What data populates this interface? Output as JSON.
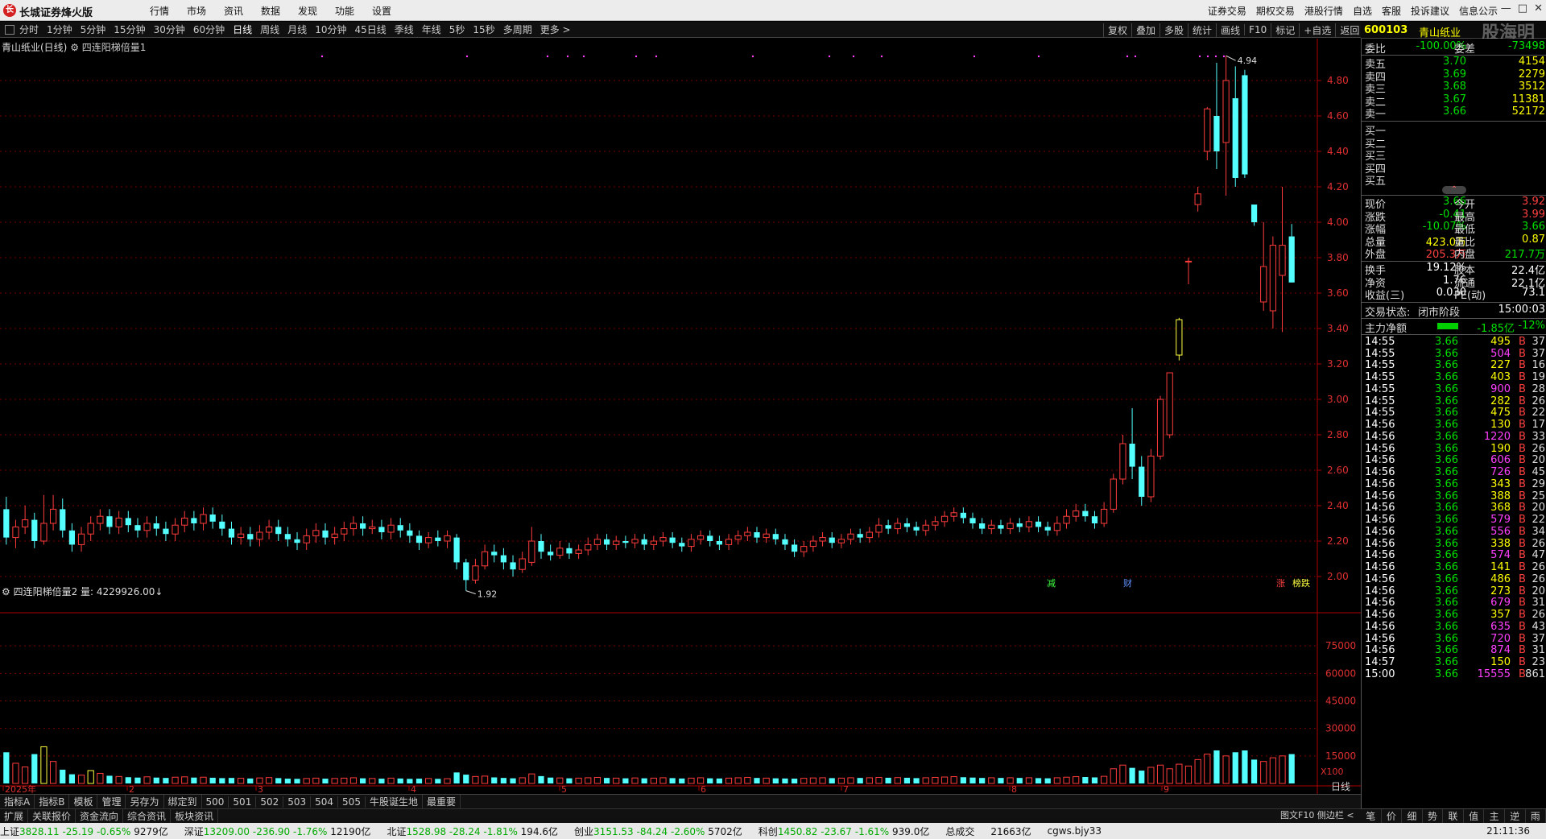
{
  "app": {
    "title": "长城证券烽火版",
    "menus": [
      "行情",
      "市场",
      "资讯",
      "数据",
      "发现",
      "功能",
      "设置"
    ],
    "right_menus": [
      "证券交易",
      "期权交易",
      "港股行情",
      "自选",
      "客服",
      "投诉建议",
      "信息公示"
    ]
  },
  "period_bar": {
    "items": [
      "分时",
      "1分钟",
      "5分钟",
      "15分钟",
      "30分钟",
      "60分钟",
      "日线",
      "周线",
      "月线",
      "10分钟",
      "45日线",
      "季线",
      "年线",
      "5秒",
      "15秒",
      "多周期",
      "更多 >"
    ],
    "active": "日线",
    "right_tools": [
      "复权",
      "叠加",
      "多股",
      "统计",
      "画线",
      "F10",
      "标记",
      "+自选",
      "返回"
    ]
  },
  "main_chart": {
    "title": "青山纸业(日线)",
    "indicator": "四连阳梯倍量1",
    "y_ticks": [
      "4.80",
      "4.60",
      "4.40",
      "4.20",
      "4.00",
      "3.80",
      "3.60",
      "3.40",
      "3.20",
      "3.00",
      "2.80",
      "2.60",
      "2.40",
      "2.20",
      "2.00"
    ],
    "high_label": "4.94",
    "low_label": "1.92",
    "markers": [
      "减",
      "财",
      "涨",
      "榜跌"
    ]
  },
  "volume_chart": {
    "title": "四连阳梯倍量2 量: 4229926.00",
    "y_ticks": [
      "75000",
      "60000",
      "45000",
      "30000",
      "15000"
    ],
    "unit": "X100"
  },
  "x_axis": [
    "2025年",
    "2",
    "3",
    "4",
    "5",
    "6",
    "7",
    "8",
    "9"
  ],
  "day_line": "日线",
  "tabs1": [
    "指标A",
    "指标B",
    "模板",
    "管理",
    "另存为",
    "绑定到",
    "500",
    "501",
    "502",
    "503",
    "504",
    "505",
    "牛股诞生地",
    "最重要"
  ],
  "tabs2": [
    "扩展",
    "关联报价",
    "资金流向",
    "综合资讯",
    "板块资讯"
  ],
  "small_btns": "图文F10  侧边栏 <",
  "right_tabs": [
    "笔",
    "价",
    "细",
    "势",
    "联",
    "值",
    "主",
    "逆",
    "雨"
  ],
  "stock": {
    "code": "600103",
    "name": "青山纸业",
    "watermark": "股海明灯",
    "webi": "委比",
    "webi_val": "-100.00%",
    "weicha": "委差",
    "weicha_val": "-73498",
    "sell": [
      {
        "label": "卖五",
        "price": "3.70",
        "vol": "4154"
      },
      {
        "label": "卖四",
        "price": "3.69",
        "vol": "2279"
      },
      {
        "label": "卖三",
        "price": "3.68",
        "vol": "3512"
      },
      {
        "label": "卖二",
        "price": "3.67",
        "vol": "11381"
      },
      {
        "label": "卖一",
        "price": "3.66",
        "vol": "52172"
      }
    ],
    "buy": [
      {
        "label": "买一"
      },
      {
        "label": "买二"
      },
      {
        "label": "买三"
      },
      {
        "label": "买四"
      },
      {
        "label": "买五"
      }
    ],
    "quote": [
      {
        "l1": "现价",
        "v1": "3.66",
        "c1": "green",
        "l2": "今开",
        "v2": "3.92",
        "c2": "red"
      },
      {
        "l1": "涨跌",
        "v1": "-0.41",
        "c1": "green",
        "l2": "最高",
        "v2": "3.99",
        "c2": "red"
      },
      {
        "l1": "涨幅",
        "v1": "-10.07%",
        "c1": "green",
        "l2": "最低",
        "v2": "3.66",
        "c2": "green"
      },
      {
        "l1": "总量",
        "v1": "423.0万",
        "c1": "yellow",
        "l2": "量比",
        "v2": "0.87",
        "c2": "yellow"
      },
      {
        "l1": "外盘",
        "v1": "205.3万",
        "c1": "red",
        "l2": "内盘",
        "v2": "217.7万",
        "c2": "green"
      }
    ],
    "quote2": [
      {
        "l1": "换手",
        "v1": "19.12%",
        "l2": "股本",
        "v2": "22.4亿"
      },
      {
        "l1": "净资",
        "v1": "1.76",
        "l2": "流通",
        "v2": "22.1亿"
      },
      {
        "l1": "收益(三)",
        "v1": "0.030",
        "l2": "PE(动)",
        "v2": "73.1"
      }
    ],
    "trade_status_label": "交易状态:",
    "trade_status": "闭市阶段",
    "trade_time": "15:00:03",
    "main_net_label": "主力净额",
    "main_net_val": "-1.85亿",
    "main_net_pct": "-12%"
  },
  "ticks": [
    {
      "t": "14:55",
      "p": "3.66",
      "v": "495",
      "m": false,
      "c": "37"
    },
    {
      "t": "14:55",
      "p": "3.66",
      "v": "504",
      "m": true,
      "c": "37"
    },
    {
      "t": "14:55",
      "p": "3.66",
      "v": "227",
      "m": false,
      "c": "16"
    },
    {
      "t": "14:55",
      "p": "3.66",
      "v": "403",
      "m": false,
      "c": "19"
    },
    {
      "t": "14:55",
      "p": "3.66",
      "v": "900",
      "m": true,
      "c": "28"
    },
    {
      "t": "14:55",
      "p": "3.66",
      "v": "282",
      "m": false,
      "c": "26"
    },
    {
      "t": "14:55",
      "p": "3.66",
      "v": "475",
      "m": false,
      "c": "22"
    },
    {
      "t": "14:56",
      "p": "3.66",
      "v": "130",
      "m": false,
      "c": "17"
    },
    {
      "t": "14:56",
      "p": "3.66",
      "v": "1220",
      "m": true,
      "c": "33"
    },
    {
      "t": "14:56",
      "p": "3.66",
      "v": "190",
      "m": false,
      "c": "26"
    },
    {
      "t": "14:56",
      "p": "3.66",
      "v": "606",
      "m": true,
      "c": "20"
    },
    {
      "t": "14:56",
      "p": "3.66",
      "v": "726",
      "m": true,
      "c": "45"
    },
    {
      "t": "14:56",
      "p": "3.66",
      "v": "343",
      "m": false,
      "c": "29"
    },
    {
      "t": "14:56",
      "p": "3.66",
      "v": "388",
      "m": false,
      "c": "25"
    },
    {
      "t": "14:56",
      "p": "3.66",
      "v": "368",
      "m": false,
      "c": "20"
    },
    {
      "t": "14:56",
      "p": "3.66",
      "v": "579",
      "m": true,
      "c": "22"
    },
    {
      "t": "14:56",
      "p": "3.66",
      "v": "556",
      "m": true,
      "c": "34"
    },
    {
      "t": "14:56",
      "p": "3.66",
      "v": "338",
      "m": false,
      "c": "26"
    },
    {
      "t": "14:56",
      "p": "3.66",
      "v": "574",
      "m": true,
      "c": "47"
    },
    {
      "t": "14:56",
      "p": "3.66",
      "v": "141",
      "m": false,
      "c": "26"
    },
    {
      "t": "14:56",
      "p": "3.66",
      "v": "486",
      "m": false,
      "c": "26"
    },
    {
      "t": "14:56",
      "p": "3.66",
      "v": "273",
      "m": false,
      "c": "20"
    },
    {
      "t": "14:56",
      "p": "3.66",
      "v": "679",
      "m": true,
      "c": "31"
    },
    {
      "t": "14:56",
      "p": "3.66",
      "v": "357",
      "m": false,
      "c": "26"
    },
    {
      "t": "14:56",
      "p": "3.66",
      "v": "635",
      "m": true,
      "c": "43"
    },
    {
      "t": "14:56",
      "p": "3.66",
      "v": "720",
      "m": true,
      "c": "37"
    },
    {
      "t": "14:56",
      "p": "3.66",
      "v": "874",
      "m": true,
      "c": "31"
    },
    {
      "t": "14:57",
      "p": "3.66",
      "v": "150",
      "m": false,
      "c": "23"
    },
    {
      "t": "15:00",
      "p": "3.66",
      "v": "15555",
      "m": true,
      "c": "861"
    }
  ],
  "statusbar": [
    {
      "name": "上证",
      "val": "3828.11",
      "chg": "-25.19",
      "pct": "-0.65%",
      "amt": "9279亿"
    },
    {
      "name": "深证",
      "val": "13209.00",
      "chg": "-236.90",
      "pct": "-1.76%",
      "amt": "12190亿"
    },
    {
      "name": "北证",
      "val": "1528.98",
      "chg": "-28.24",
      "pct": "-1.81%",
      "amt": "194.6亿"
    },
    {
      "name": "创业",
      "val": "3151.53",
      "chg": "-84.24",
      "pct": "-2.60%",
      "amt": "5702亿"
    },
    {
      "name": "科创",
      "val": "1450.82",
      "chg": "-23.67",
      "pct": "-1.61%",
      "amt": "939.0亿"
    }
  ],
  "status_total_label": "总成交",
  "status_total": "21663亿",
  "status_server": "cgws.bjy33",
  "status_time": "21:11:36",
  "chart_data": {
    "type": "candlestick",
    "title": "青山纸业(日线)",
    "y_range": [
      1.9,
      5.0
    ],
    "volume_range": [
      0,
      90000
    ],
    "candles": [
      [
        2.38,
        2.22,
        2.45,
        2.18
      ],
      [
        2.22,
        2.28,
        2.32,
        2.16
      ],
      [
        2.28,
        2.32,
        2.4,
        2.24
      ],
      [
        2.32,
        2.2,
        2.36,
        2.16
      ],
      [
        2.2,
        2.3,
        2.46,
        2.18
      ],
      [
        2.3,
        2.38,
        2.46,
        2.26
      ],
      [
        2.38,
        2.26,
        2.44,
        2.22
      ],
      [
        2.26,
        2.18,
        2.3,
        2.14
      ],
      [
        2.18,
        2.24,
        2.28,
        2.14
      ],
      [
        2.24,
        2.3,
        2.34,
        2.2
      ],
      [
        2.3,
        2.34,
        2.38,
        2.26
      ],
      [
        2.34,
        2.28,
        2.38,
        2.24
      ],
      [
        2.28,
        2.33,
        2.37,
        2.24
      ],
      [
        2.33,
        2.29,
        2.37,
        2.25
      ],
      [
        2.29,
        2.26,
        2.33,
        2.22
      ],
      [
        2.26,
        2.3,
        2.34,
        2.22
      ],
      [
        2.3,
        2.27,
        2.34,
        2.23
      ],
      [
        2.27,
        2.24,
        2.31,
        2.2
      ],
      [
        2.24,
        2.29,
        2.33,
        2.2
      ],
      [
        2.29,
        2.33,
        2.37,
        2.25
      ],
      [
        2.33,
        2.3,
        2.37,
        2.26
      ],
      [
        2.3,
        2.35,
        2.39,
        2.26
      ],
      [
        2.35,
        2.31,
        2.39,
        2.27
      ],
      [
        2.31,
        2.27,
        2.35,
        2.23
      ],
      [
        2.27,
        2.22,
        2.31,
        2.18
      ],
      [
        2.22,
        2.24,
        2.28,
        2.18
      ],
      [
        2.24,
        2.21,
        2.28,
        2.17
      ],
      [
        2.21,
        2.25,
        2.29,
        2.17
      ],
      [
        2.25,
        2.28,
        2.32,
        2.21
      ],
      [
        2.28,
        2.24,
        2.32,
        2.2
      ],
      [
        2.24,
        2.21,
        2.28,
        2.17
      ],
      [
        2.21,
        2.19,
        2.25,
        2.15
      ],
      [
        2.19,
        2.23,
        2.27,
        2.15
      ],
      [
        2.23,
        2.26,
        2.3,
        2.19
      ],
      [
        2.26,
        2.22,
        2.3,
        2.18
      ],
      [
        2.22,
        2.24,
        2.28,
        2.18
      ],
      [
        2.24,
        2.27,
        2.31,
        2.2
      ],
      [
        2.27,
        2.3,
        2.34,
        2.23
      ],
      [
        2.3,
        2.27,
        2.34,
        2.23
      ],
      [
        2.27,
        2.28,
        2.32,
        2.24
      ],
      [
        2.28,
        2.25,
        2.32,
        2.21
      ],
      [
        2.25,
        2.29,
        2.33,
        2.21
      ],
      [
        2.29,
        2.26,
        2.33,
        2.22
      ],
      [
        2.26,
        2.23,
        2.3,
        2.19
      ],
      [
        2.23,
        2.19,
        2.26,
        2.15
      ],
      [
        2.19,
        2.22,
        2.25,
        2.16
      ],
      [
        2.22,
        2.2,
        2.26,
        2.17
      ],
      [
        2.2,
        2.23,
        2.26,
        2.16
      ],
      [
        2.22,
        2.08,
        2.24,
        2.04
      ],
      [
        2.08,
        1.98,
        2.1,
        1.92
      ],
      [
        1.98,
        2.06,
        2.1,
        1.96
      ],
      [
        2.06,
        2.14,
        2.18,
        2.04
      ],
      [
        2.14,
        2.12,
        2.18,
        2.08
      ],
      [
        2.12,
        2.08,
        2.16,
        2.04
      ],
      [
        2.08,
        2.04,
        2.12,
        2.0
      ],
      [
        2.04,
        2.1,
        2.14,
        2.02
      ],
      [
        2.08,
        2.2,
        2.28,
        2.06
      ],
      [
        2.2,
        2.14,
        2.24,
        2.1
      ],
      [
        2.14,
        2.12,
        2.18,
        2.09
      ],
      [
        2.12,
        2.16,
        2.2,
        2.1
      ],
      [
        2.16,
        2.13,
        2.19,
        2.1
      ],
      [
        2.13,
        2.15,
        2.18,
        2.1
      ],
      [
        2.15,
        2.18,
        2.22,
        2.12
      ],
      [
        2.18,
        2.21,
        2.24,
        2.15
      ],
      [
        2.21,
        2.18,
        2.24,
        2.15
      ],
      [
        2.18,
        2.2,
        2.23,
        2.15
      ],
      [
        2.2,
        2.19,
        2.23,
        2.16
      ],
      [
        2.19,
        2.21,
        2.24,
        2.16
      ],
      [
        2.21,
        2.18,
        2.24,
        2.15
      ],
      [
        2.18,
        2.2,
        2.23,
        2.15
      ],
      [
        2.2,
        2.22,
        2.25,
        2.17
      ],
      [
        2.22,
        2.19,
        2.25,
        2.16
      ],
      [
        2.19,
        2.17,
        2.22,
        2.14
      ],
      [
        2.17,
        2.21,
        2.24,
        2.14
      ],
      [
        2.21,
        2.23,
        2.26,
        2.18
      ],
      [
        2.23,
        2.2,
        2.26,
        2.17
      ],
      [
        2.2,
        2.18,
        2.23,
        2.15
      ],
      [
        2.18,
        2.21,
        2.24,
        2.15
      ],
      [
        2.21,
        2.23,
        2.26,
        2.18
      ],
      [
        2.23,
        2.25,
        2.28,
        2.2
      ],
      [
        2.25,
        2.22,
        2.28,
        2.19
      ],
      [
        2.22,
        2.24,
        2.27,
        2.19
      ],
      [
        2.24,
        2.21,
        2.27,
        2.18
      ],
      [
        2.21,
        2.18,
        2.24,
        2.15
      ],
      [
        2.18,
        2.14,
        2.21,
        2.11
      ],
      [
        2.14,
        2.17,
        2.2,
        2.11
      ],
      [
        2.17,
        2.2,
        2.23,
        2.14
      ],
      [
        2.2,
        2.22,
        2.25,
        2.17
      ],
      [
        2.22,
        2.19,
        2.25,
        2.16
      ],
      [
        2.19,
        2.21,
        2.24,
        2.16
      ],
      [
        2.21,
        2.24,
        2.27,
        2.18
      ],
      [
        2.24,
        2.22,
        2.27,
        2.19
      ],
      [
        2.22,
        2.25,
        2.28,
        2.19
      ],
      [
        2.25,
        2.29,
        2.33,
        2.22
      ],
      [
        2.29,
        2.27,
        2.32,
        2.24
      ],
      [
        2.27,
        2.3,
        2.33,
        2.24
      ],
      [
        2.3,
        2.28,
        2.33,
        2.25
      ],
      [
        2.28,
        2.26,
        2.31,
        2.23
      ],
      [
        2.26,
        2.29,
        2.32,
        2.23
      ],
      [
        2.29,
        2.31,
        2.34,
        2.26
      ],
      [
        2.31,
        2.34,
        2.37,
        2.28
      ],
      [
        2.34,
        2.36,
        2.39,
        2.31
      ],
      [
        2.36,
        2.33,
        2.39,
        2.3
      ],
      [
        2.33,
        2.3,
        2.36,
        2.27
      ],
      [
        2.3,
        2.27,
        2.33,
        2.24
      ],
      [
        2.27,
        2.29,
        2.32,
        2.24
      ],
      [
        2.29,
        2.27,
        2.32,
        2.24
      ],
      [
        2.27,
        2.3,
        2.33,
        2.24
      ],
      [
        2.3,
        2.28,
        2.33,
        2.25
      ],
      [
        2.28,
        2.31,
        2.34,
        2.25
      ],
      [
        2.31,
        2.28,
        2.34,
        2.25
      ],
      [
        2.28,
        2.26,
        2.31,
        2.23
      ],
      [
        2.26,
        2.3,
        2.34,
        2.23
      ],
      [
        2.3,
        2.34,
        2.38,
        2.27
      ],
      [
        2.34,
        2.37,
        2.41,
        2.31
      ],
      [
        2.37,
        2.34,
        2.41,
        2.31
      ],
      [
        2.34,
        2.3,
        2.37,
        2.27
      ],
      [
        2.3,
        2.38,
        2.42,
        2.28
      ],
      [
        2.38,
        2.55,
        2.58,
        2.36
      ],
      [
        2.55,
        2.75,
        2.8,
        2.52
      ],
      [
        2.75,
        2.62,
        2.95,
        2.55
      ],
      [
        2.62,
        2.45,
        2.68,
        2.4
      ],
      [
        2.45,
        2.68,
        2.72,
        2.42
      ],
      [
        2.68,
        3.0,
        3.02,
        2.66
      ],
      [
        2.8,
        3.15,
        3.15,
        2.78
      ],
      [
        3.25,
        3.45,
        3.46,
        3.22
      ],
      [
        3.78,
        3.78,
        3.8,
        3.65
      ],
      [
        4.1,
        4.16,
        4.2,
        4.06
      ],
      [
        4.4,
        4.64,
        4.65,
        4.35
      ],
      [
        4.6,
        4.4,
        4.9,
        4.3
      ],
      [
        4.45,
        4.8,
        4.94,
        4.15
      ],
      [
        4.7,
        4.25,
        4.88,
        4.2
      ],
      [
        4.83,
        4.27,
        4.86,
        4.25
      ],
      [
        4.1,
        4.0,
        4.06,
        3.98
      ],
      [
        3.55,
        3.75,
        4.0,
        3.5
      ],
      [
        3.5,
        3.87,
        3.92,
        3.4
      ],
      [
        3.7,
        3.87,
        4.2,
        3.38
      ],
      [
        3.92,
        3.66,
        3.99,
        3.66
      ]
    ],
    "volumes": [
      17000,
      11000,
      9000,
      16000,
      20000,
      12000,
      7500,
      5000,
      4500,
      7000,
      5500,
      4200,
      3800,
      3400,
      3200,
      3600,
      3200,
      3000,
      3400,
      3600,
      3200,
      3400,
      3100,
      2900,
      3000,
      2800,
      2700,
      3000,
      3200,
      2900,
      2600,
      2500,
      2700,
      2900,
      2600,
      2700,
      2900,
      3100,
      2800,
      2700,
      2600,
      2900,
      2700,
      2500,
      2600,
      2700,
      2500,
      2600,
      6000,
      4800,
      3800,
      4000,
      3300,
      3000,
      2800,
      3100,
      5200,
      4000,
      3200,
      3000,
      2800,
      2900,
      3100,
      3300,
      3000,
      2900,
      2800,
      3000,
      2800,
      2900,
      3100,
      2900,
      2700,
      2900,
      3100,
      2800,
      2700,
      2900,
      3100,
      3300,
      3000,
      2900,
      2800,
      2700,
      2600,
      2800,
      3000,
      3100,
      2900,
      2900,
      3100,
      3000,
      3100,
      3300,
      3100,
      3200,
      3100,
      2900,
      3100,
      3300,
      3500,
      3700,
      3400,
      3200,
      3000,
      3100,
      3000,
      3100,
      3000,
      3100,
      2900,
      2800,
      3100,
      3400,
      3700,
      3500,
      3300,
      3900,
      8000,
      10000,
      8500,
      7000,
      8800,
      10000,
      8000,
      10500,
      9500,
      13000,
      16000,
      18000,
      15000,
      17000,
      18000,
      13000,
      12000,
      14000,
      15000,
      16000
    ]
  }
}
